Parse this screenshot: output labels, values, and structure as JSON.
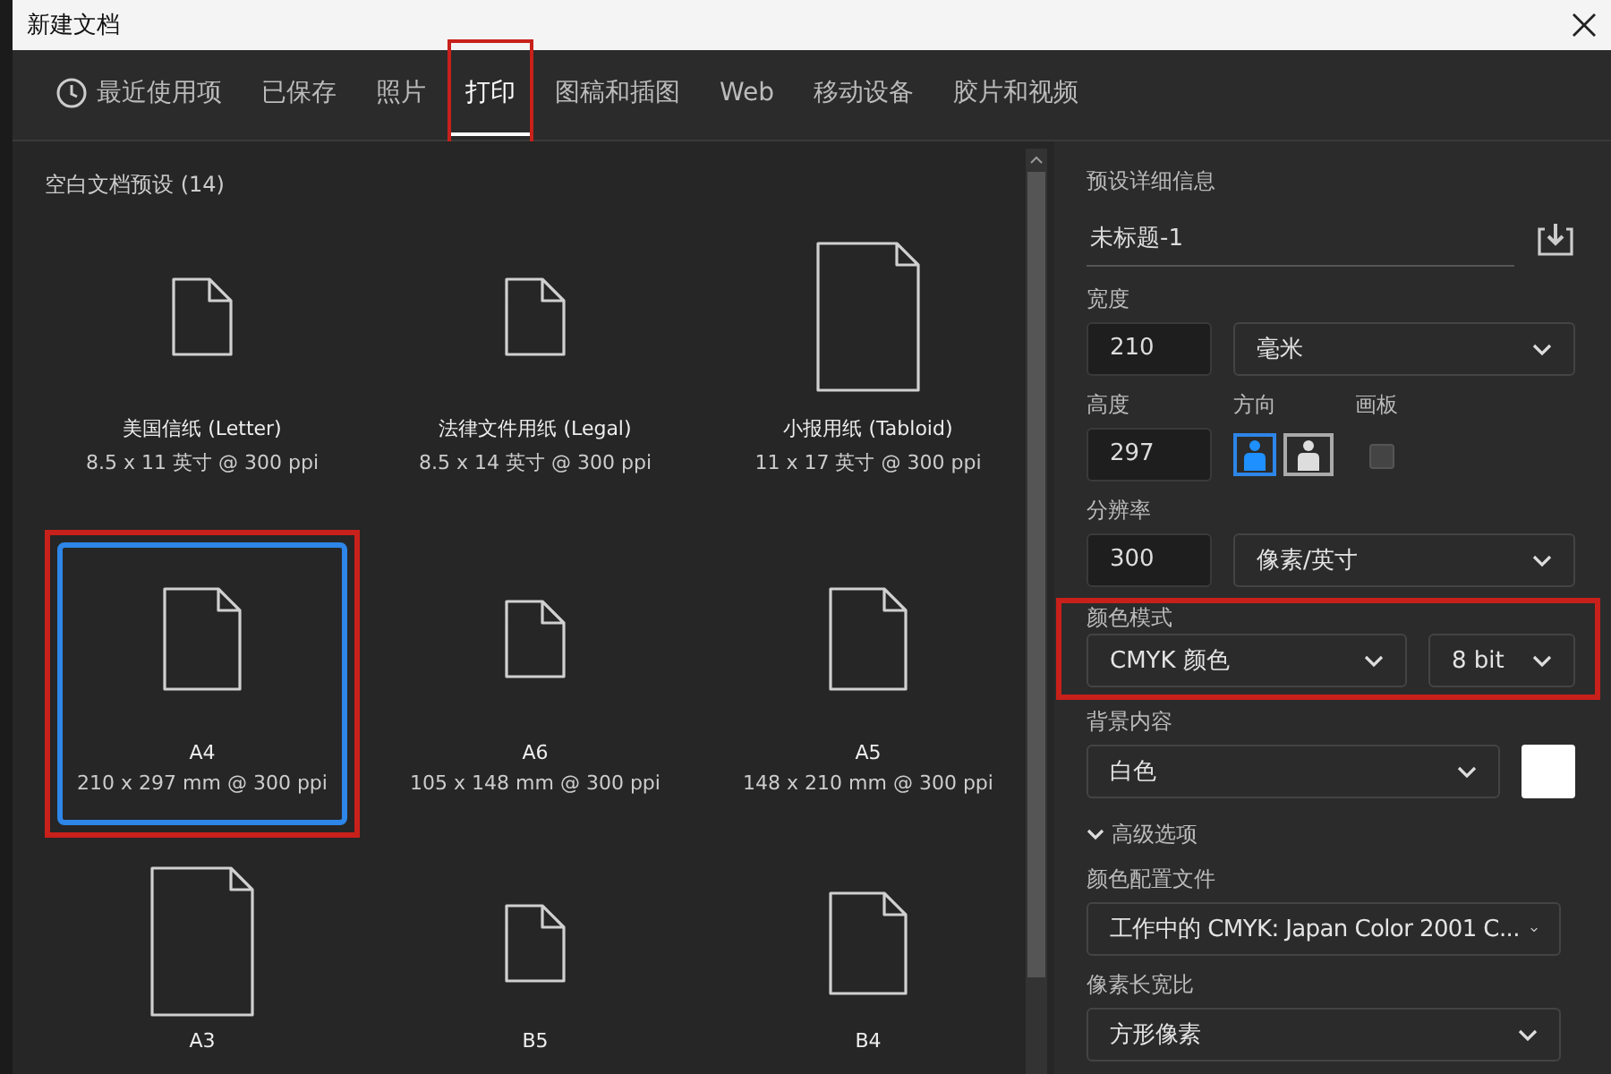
{
  "window": {
    "title": "新建文档"
  },
  "tabs": [
    {
      "label": "最近使用项",
      "selected": false,
      "kind": "recent",
      "highlighted": false
    },
    {
      "label": "已保存",
      "selected": false,
      "kind": "category",
      "highlighted": false
    },
    {
      "label": "照片",
      "selected": false,
      "kind": "category",
      "highlighted": false
    },
    {
      "label": "打印",
      "selected": true,
      "kind": "category",
      "highlighted": true
    },
    {
      "label": "图稿和插图",
      "selected": false,
      "kind": "category",
      "highlighted": false
    },
    {
      "label": "Web",
      "selected": false,
      "kind": "category",
      "highlighted": false
    },
    {
      "label": "移动设备",
      "selected": false,
      "kind": "category",
      "highlighted": false
    },
    {
      "label": "胶片和视频",
      "selected": false,
      "kind": "category",
      "highlighted": false
    }
  ],
  "presets": {
    "heading": "空白文档预设 (14)",
    "items": [
      {
        "name": "美国信纸 (Letter)",
        "size": "8.5 x 11 英寸 @ 300 ppi",
        "kind": "small",
        "selected": false,
        "highlighted": false
      },
      {
        "name": "法律文件用纸 (Legal)",
        "size": "8.5 x 14 英寸 @ 300 ppi",
        "kind": "small",
        "selected": false,
        "highlighted": false
      },
      {
        "name": "小报用纸 (Tabloid)",
        "size": "11 x 17 英寸 @ 300 ppi",
        "kind": "large",
        "selected": false,
        "highlighted": false
      },
      {
        "name": "A4",
        "size": "210 x 297 mm @ 300 ppi",
        "kind": "medium",
        "selected": true,
        "highlighted": true
      },
      {
        "name": "A6",
        "size": "105 x 148 mm @ 300 ppi",
        "kind": "small",
        "selected": false,
        "highlighted": false
      },
      {
        "name": "A5",
        "size": "148 x 210 mm @ 300 ppi",
        "kind": "medium",
        "selected": false,
        "highlighted": false
      },
      {
        "name": "A3",
        "kind": "large",
        "selected": false,
        "highlighted": false
      },
      {
        "name": "B5",
        "kind": "small",
        "selected": false,
        "highlighted": false
      },
      {
        "name": "B4",
        "kind": "medium",
        "selected": false,
        "highlighted": false
      }
    ]
  },
  "details": {
    "heading": "预设详细信息",
    "name": "未标题-1",
    "width": {
      "label": "宽度",
      "value": "210",
      "unit": "毫米"
    },
    "height": {
      "label": "高度",
      "value": "297"
    },
    "orientation": {
      "label": "方向",
      "options": [
        {
          "kind": "portrait",
          "selected": true
        },
        {
          "kind": "landscape",
          "selected": false
        }
      ]
    },
    "artboard": {
      "label": "画板",
      "checked": false
    },
    "resolution": {
      "label": "分辨率",
      "value": "300",
      "unit": "像素/英寸"
    },
    "color_mode": {
      "label": "颜色模式",
      "mode": "CMYK 颜色",
      "depth": "8 bit",
      "highlighted": true
    },
    "background": {
      "label": "背景内容",
      "value": "白色",
      "color": "#ffffff"
    },
    "advanced": {
      "label": "高级选项",
      "expanded": true
    },
    "color_profile": {
      "label": "颜色配置文件",
      "value": "工作中的 CMYK: Japan Color 2001 C..."
    },
    "pixel_aspect": {
      "label": "像素长宽比",
      "value": "方形像素"
    }
  }
}
